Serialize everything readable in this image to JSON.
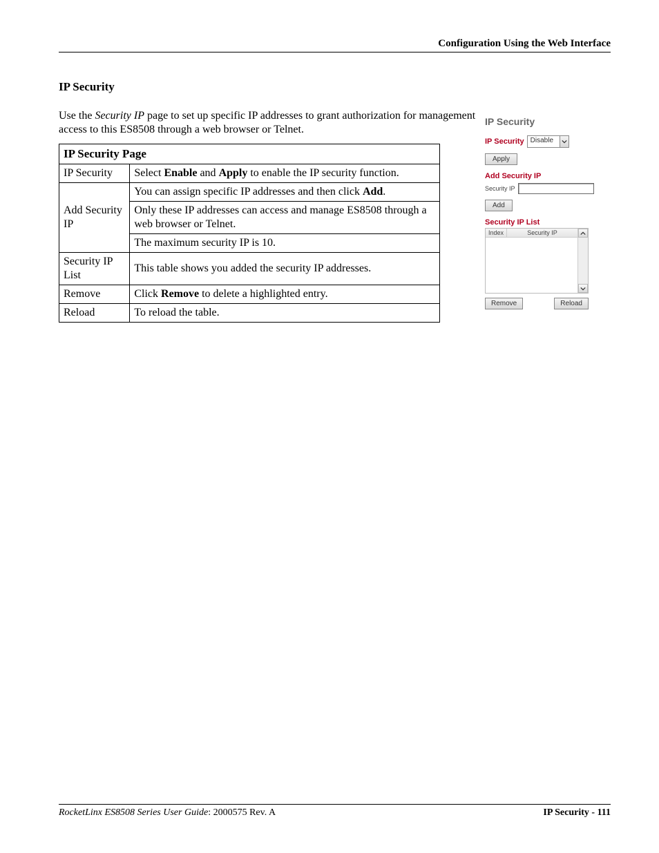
{
  "header": {
    "breadcrumb": "Configuration Using the Web Interface"
  },
  "section": {
    "title": "IP Security"
  },
  "intro": {
    "pre": "Use the ",
    "italic": "Security IP",
    "post": " page to set up specific IP addresses to grant authorization for management access to this ES8508 through a web browser or Telnet."
  },
  "table": {
    "title": "IP Security Page",
    "rows": [
      {
        "label": "IP Security",
        "desc": [
          {
            "html": "Select <span class=\"b\">Enable</span> and <span class=\"b\">Apply</span> to enable the IP security function."
          }
        ]
      },
      {
        "label": "Add Security IP",
        "desc": [
          {
            "html": "You can assign specific IP addresses and then click <span class=\"b\">Add</span>."
          },
          {
            "html": "Only these IP addresses can access and manage ES8508 through a web browser or Telnet."
          },
          {
            "html": "The maximum security IP is 10."
          }
        ]
      },
      {
        "label": "Security IP List",
        "desc": [
          {
            "html": "This table shows you added the security IP addresses."
          }
        ]
      },
      {
        "label": "Remove",
        "desc": [
          {
            "html": "Click <span class=\"b\">Remove</span> to delete a highlighted entry."
          }
        ]
      },
      {
        "label": "Reload",
        "desc": [
          {
            "html": "To reload the table."
          }
        ]
      }
    ]
  },
  "ui": {
    "title": "IP Security",
    "ip_security": {
      "label": "IP Security",
      "select_value": "Disable",
      "apply": "Apply"
    },
    "add_security": {
      "heading": "Add Security IP",
      "label": "Security IP",
      "input_value": "",
      "add": "Add"
    },
    "list": {
      "heading": "Security IP List",
      "col_index": "Index",
      "col_ip": "Security IP",
      "remove": "Remove",
      "reload": "Reload"
    }
  },
  "footer": {
    "left_italic": "RocketLinx ES8508 Series  User Guide",
    "left_rest": ": 2000575 Rev. A",
    "right": "IP Security - 111"
  }
}
